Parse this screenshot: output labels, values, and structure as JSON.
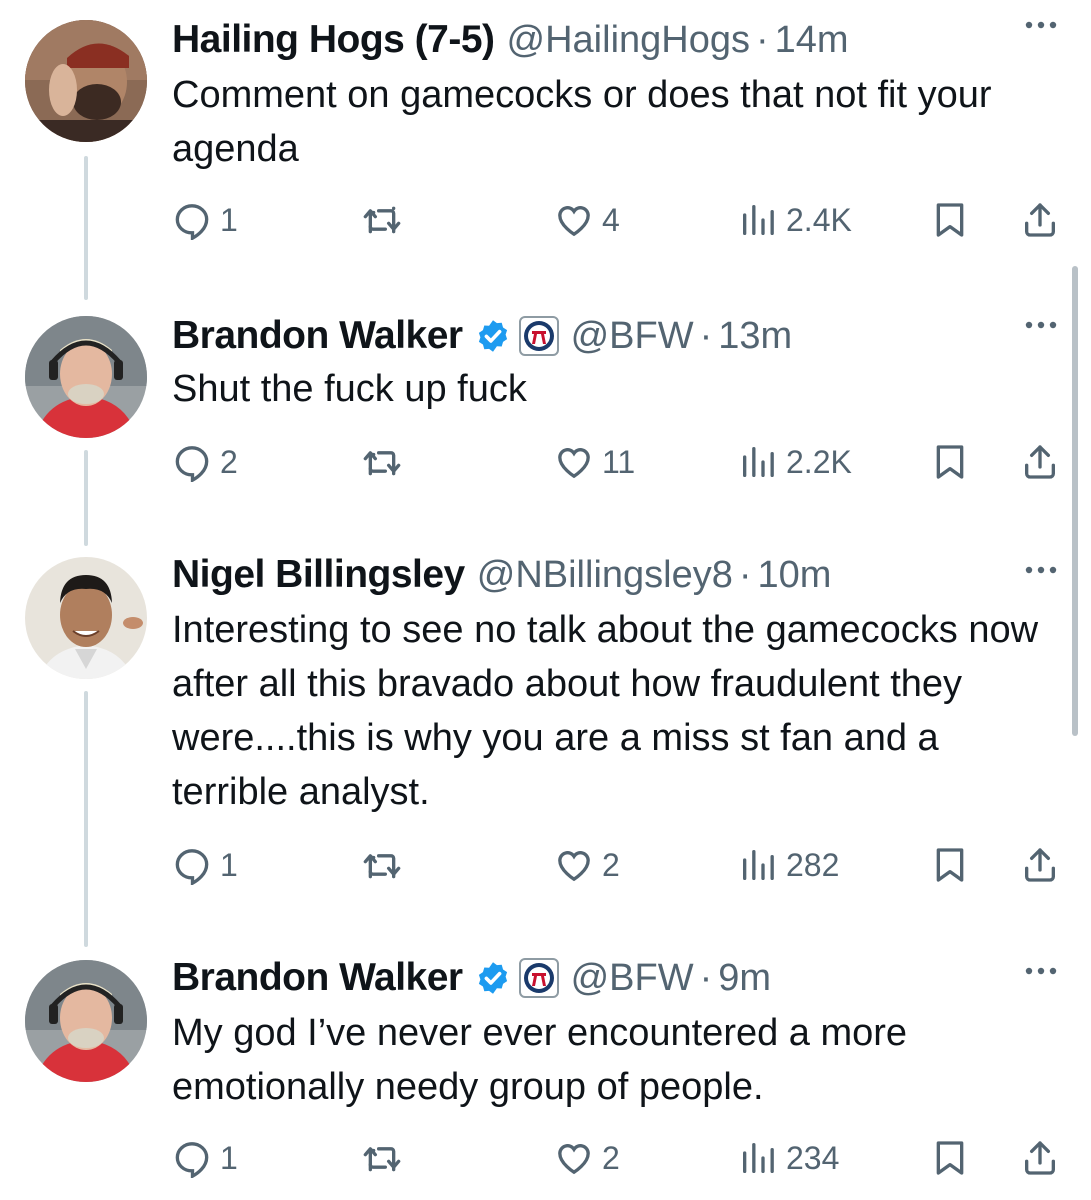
{
  "tweets": [
    {
      "name": "Hailing Hogs (7-5)",
      "handle": "@HailingHogs",
      "separator": "·",
      "time": "14m",
      "verified": false,
      "affiliate_badge": false,
      "text": "Comment on gamecocks or does that not fit your agenda",
      "replies": "1",
      "retweets": "",
      "likes": "4",
      "views": "2.4K"
    },
    {
      "name": "Brandon Walker",
      "handle": "@BFW",
      "separator": "·",
      "time": "13m",
      "verified": true,
      "affiliate_badge": true,
      "text": "Shut the fuck up fuck",
      "replies": "2",
      "retweets": "",
      "likes": "11",
      "views": "2.2K"
    },
    {
      "name": "Nigel Billingsley",
      "handle": "@NBillingsley8",
      "separator": "·",
      "time": "10m",
      "verified": false,
      "affiliate_badge": false,
      "text": "Interesting to see no talk about the gamecocks now after all this bravado about how fraudulent they were....this is why you are a miss st fan and a terrible analyst.",
      "replies": "1",
      "retweets": "",
      "likes": "2",
      "views": "282"
    },
    {
      "name": "Brandon Walker",
      "handle": "@BFW",
      "separator": "·",
      "time": "9m",
      "verified": true,
      "affiliate_badge": true,
      "text": "My god I’ve never ever encountered a more emotionally needy group of people.",
      "replies": "1",
      "retweets": "",
      "likes": "2",
      "views": "234"
    }
  ],
  "colors": {
    "text": "#0f1419",
    "secondary": "#536471",
    "verified": "#1d9bf0",
    "thread_line": "#cfd9de"
  },
  "icons": [
    "reply-icon",
    "retweet-icon",
    "like-icon",
    "views-icon",
    "bookmark-icon",
    "share-icon",
    "more-icon",
    "verified-icon",
    "barstool-badge-icon"
  ]
}
